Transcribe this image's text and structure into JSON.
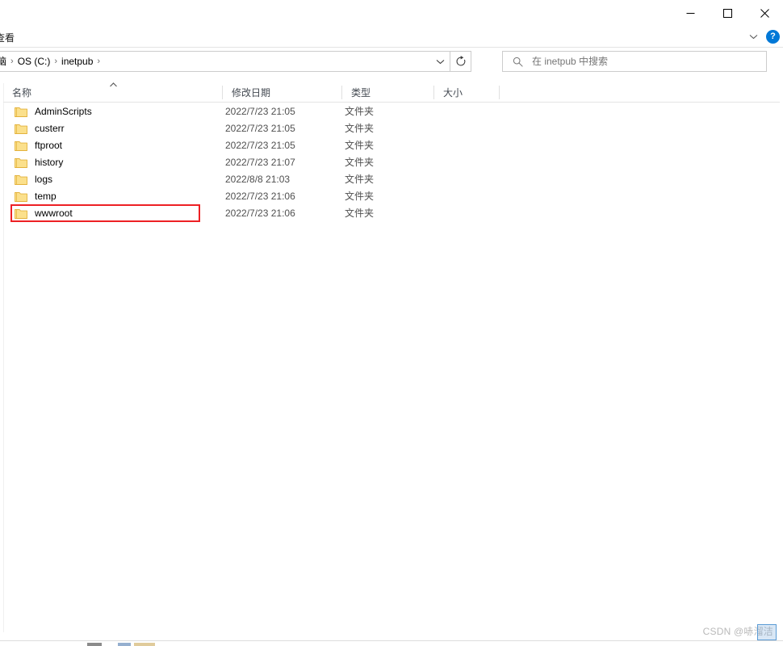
{
  "window": {
    "controls": {
      "minimize_label": "最小化",
      "maximize_label": "最大化",
      "close_label": "关闭"
    }
  },
  "ribbon": {
    "tabs": [
      {
        "label": "查看"
      }
    ],
    "expand_label": "",
    "help_label": "?"
  },
  "address": {
    "breadcrumbs": [
      {
        "label": "脑"
      },
      {
        "label": "OS (C:)"
      },
      {
        "label": "inetpub"
      }
    ],
    "separator": "›",
    "dropdown_label": "",
    "refresh_label": ""
  },
  "search": {
    "placeholder": "在 inetpub 中搜索",
    "value": "",
    "icon": "search-icon"
  },
  "columns": [
    {
      "key": "name",
      "label": "名称",
      "sorted": "asc"
    },
    {
      "key": "date",
      "label": "修改日期",
      "sorted": ""
    },
    {
      "key": "type",
      "label": "类型",
      "sorted": ""
    },
    {
      "key": "size",
      "label": "大小",
      "sorted": ""
    }
  ],
  "files": [
    {
      "name": "AdminScripts",
      "date": "2022/7/23 21:05",
      "type": "文件夹",
      "size": "",
      "icon": "folder-icon",
      "highlighted": false
    },
    {
      "name": "custerr",
      "date": "2022/7/23 21:05",
      "type": "文件夹",
      "size": "",
      "icon": "folder-icon",
      "highlighted": false
    },
    {
      "name": "ftproot",
      "date": "2022/7/23 21:05",
      "type": "文件夹",
      "size": "",
      "icon": "folder-icon",
      "highlighted": false
    },
    {
      "name": "history",
      "date": "2022/7/23 21:07",
      "type": "文件夹",
      "size": "",
      "icon": "folder-icon",
      "highlighted": false
    },
    {
      "name": "logs",
      "date": "2022/8/8 21:03",
      "type": "文件夹",
      "size": "",
      "icon": "folder-icon",
      "highlighted": false
    },
    {
      "name": "temp",
      "date": "2022/7/23 21:06",
      "type": "文件夹",
      "size": "",
      "icon": "folder-icon",
      "highlighted": false
    },
    {
      "name": "wwwroot",
      "date": "2022/7/23 21:06",
      "type": "文件夹",
      "size": "",
      "icon": "folder-icon",
      "highlighted": true
    }
  ],
  "annotation": {
    "target": "wwwroot",
    "color": "#ed2024",
    "shape": "rectangle"
  },
  "watermark": {
    "text": "CSDN @哧溜洁"
  },
  "colors": {
    "accent": "#0078d7",
    "folder_fill": "#fbe08c",
    "folder_stroke": "#e3b23c",
    "annotation_red": "#ed2024",
    "header_text": "#444a52",
    "body_text": "#000000",
    "secondary_text": "#4f4f4f",
    "placeholder_text": "#767676",
    "border": "#cccccc"
  }
}
